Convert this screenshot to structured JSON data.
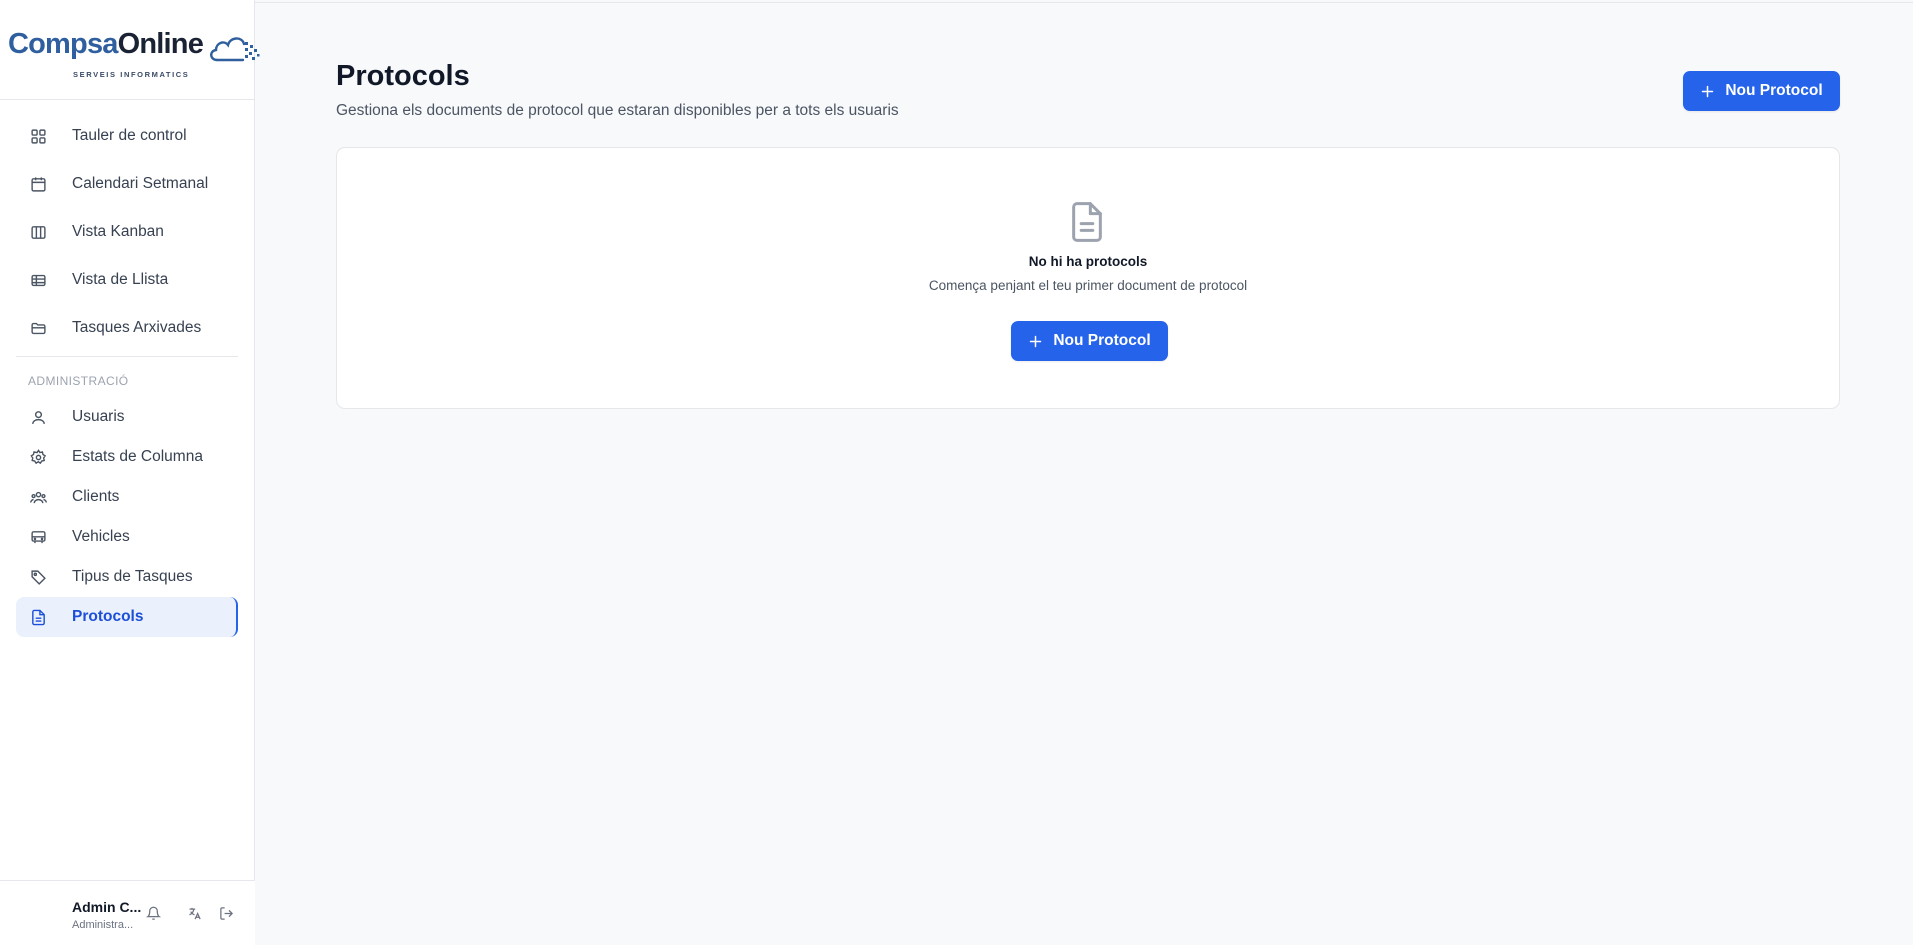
{
  "brand": {
    "name_part1": "Compsa",
    "name_part2": "Online",
    "tagline": "SERVEIS INFORMATICS"
  },
  "sidebar": {
    "items": [
      {
        "label": "Tauler de control",
        "icon": "grid-icon"
      },
      {
        "label": "Calendari Setmanal",
        "icon": "calendar-icon"
      },
      {
        "label": "Vista Kanban",
        "icon": "columns-icon"
      },
      {
        "label": "Vista de Llista",
        "icon": "table-icon"
      },
      {
        "label": "Tasques Arxivades",
        "icon": "folder-icon"
      }
    ],
    "admin_section_label": "ADMINISTRACIÓ",
    "admin_items": [
      {
        "label": "Usuaris",
        "icon": "user-icon"
      },
      {
        "label": "Estats de Columna",
        "icon": "gear-icon"
      },
      {
        "label": "Clients",
        "icon": "users-icon"
      },
      {
        "label": "Vehicles",
        "icon": "bus-icon"
      },
      {
        "label": "Tipus de Tasques",
        "icon": "tag-icon"
      },
      {
        "label": "Protocols",
        "icon": "file-text-icon",
        "active": true
      }
    ],
    "footer": {
      "user_name": "Admin C...",
      "user_role": "Administra..."
    }
  },
  "main": {
    "title": "Protocols",
    "subtitle": "Gestiona els documents de protocol que estaran disponibles per a tots els usuaris",
    "new_button_label": "Nou Protocol",
    "empty_state": {
      "title": "No hi ha protocols",
      "subtitle": "Comença penjant el teu primer document de protocol",
      "button_label": "Nou Protocol"
    }
  },
  "colors": {
    "accent": "#2563eb",
    "active_bg": "#eaf1fd",
    "brand_blue": "#2f5f9e"
  }
}
